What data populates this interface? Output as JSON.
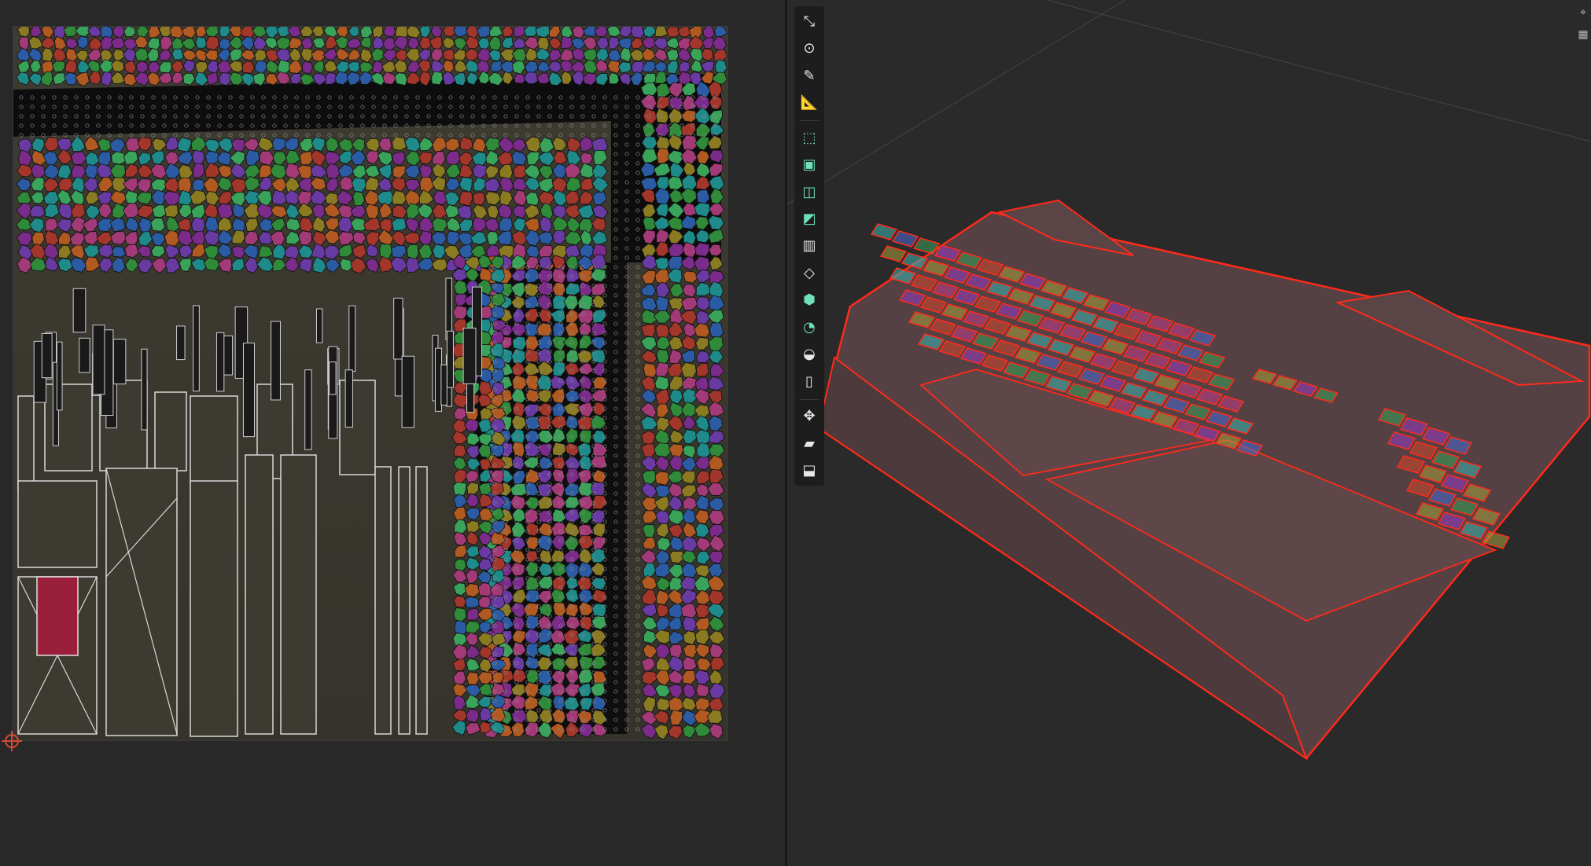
{
  "window": {
    "background": "#262626"
  },
  "uv_editor": {
    "panel": "uv-editor",
    "island_colors": [
      "#7b2b8a",
      "#2f8a3a",
      "#a3362a",
      "#2a5ba3",
      "#8a7a22",
      "#1f8a8a",
      "#a33a78",
      "#6a3aa3",
      "#3aa35a",
      "#b05a22"
    ]
  },
  "toolbar": {
    "tools": [
      {
        "id": "scale-cage",
        "icon": "scale-cage-icon",
        "glyph": "⤡",
        "color": "accent"
      },
      {
        "id": "transform",
        "icon": "transform-icon",
        "glyph": "⊙",
        "color": "accent"
      },
      {
        "id": "annotate",
        "icon": "annotate-pen-icon",
        "glyph": "✎",
        "color": "accent"
      },
      {
        "id": "measure",
        "icon": "measure-ruler-icon",
        "glyph": "📐",
        "color": "accent"
      },
      {
        "id": "add-cube",
        "icon": "add-cube-icon",
        "glyph": "⬚",
        "color": "green"
      },
      {
        "id": "extrude",
        "icon": "extrude-region-icon",
        "glyph": "▣",
        "color": "green"
      },
      {
        "id": "inset",
        "icon": "inset-faces-icon",
        "glyph": "◫",
        "color": "green"
      },
      {
        "id": "bevel",
        "icon": "bevel-icon",
        "glyph": "◩",
        "color": "green"
      },
      {
        "id": "loop-cut",
        "icon": "loop-cut-icon",
        "glyph": "▥",
        "color": "accent"
      },
      {
        "id": "knife",
        "icon": "knife-icon",
        "glyph": "◇",
        "color": "accent"
      },
      {
        "id": "poly-build",
        "icon": "poly-build-icon",
        "glyph": "⬢",
        "color": "green"
      },
      {
        "id": "spin",
        "icon": "spin-icon",
        "glyph": "◔",
        "color": "green"
      },
      {
        "id": "smooth",
        "icon": "smooth-vertices-icon",
        "glyph": "◒",
        "color": "accent"
      },
      {
        "id": "edge-slide",
        "icon": "edge-slide-icon",
        "glyph": "▯",
        "color": "accent"
      },
      {
        "id": "shrink-fatten",
        "icon": "shrink-fatten-icon",
        "glyph": "✥",
        "color": "accent"
      },
      {
        "id": "shear",
        "icon": "shear-icon",
        "glyph": "▰",
        "color": "accent"
      },
      {
        "id": "rip",
        "icon": "rip-region-icon",
        "glyph": "⬓",
        "color": "accent"
      }
    ]
  },
  "viewport": {
    "panel": "3d-viewport",
    "wire_color": "#ff2a1a",
    "mesh_fill": "#5a4446",
    "key_colors": [
      "#c43a8a",
      "#3aa356",
      "#d6472a",
      "#4a6ad6",
      "#a8a13a",
      "#9a3ac4",
      "#3ab5b0"
    ],
    "nav_icons": [
      {
        "id": "camera",
        "icon": "camera-icon",
        "glyph": "⌖"
      },
      {
        "id": "grid",
        "icon": "grid-icon",
        "glyph": "▦"
      }
    ]
  }
}
